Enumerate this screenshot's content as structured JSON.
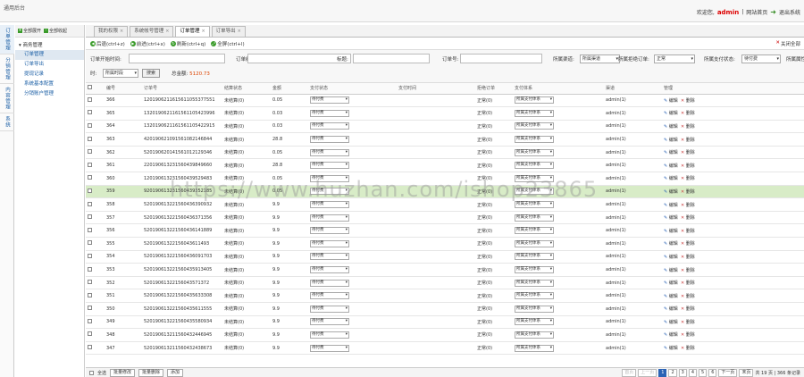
{
  "app_title": "通用后台",
  "header": {
    "welcome": "欢迎您,",
    "admin": "admin",
    "separator": "|",
    "site_home": "网站首页",
    "logout": "退出系统"
  },
  "vertical_tabs": [
    "订单管理",
    "分销管理",
    "内容管理",
    "系统"
  ],
  "sidebar": {
    "expand_all": "全部展开",
    "collapse_all": "全部收起",
    "group": "商务管理",
    "items": [
      "订单管理",
      "订单导出",
      "提现记录",
      "系统基本配置",
      "分销账户管理"
    ]
  },
  "tabs": [
    {
      "label": "我的权限",
      "close": "×"
    },
    {
      "label": "系统帐号管理",
      "close": "×"
    },
    {
      "label": "订单管理",
      "close": "×"
    },
    {
      "label": "订单导出",
      "close": "×"
    }
  ],
  "toolbar": {
    "back": "后退(ctrl+z)",
    "forward": "前进(ctrl+x)",
    "refresh": "刷新(ctrl+q)",
    "fullscreen": "全屏(ctrl+l)",
    "close_all": "关闭全部"
  },
  "filters": {
    "order_start_time": "订单开始时间:",
    "order_end_time": "订单结束时间:",
    "title": "标题:",
    "order_no": "订单号:",
    "channel": "所属渠道:",
    "channel_value": "所属渠道",
    "frozen": "所属拒绝订单:",
    "frozen_value": "正常",
    "pay_status": "所属支付状态:",
    "pay_status_value": "待付费",
    "attribute": "所属属性",
    "time": "时:",
    "time_value": "所属时段",
    "search": "搜索",
    "total_label": "总金额:",
    "total_value": "5120.73"
  },
  "table": {
    "headers": [
      "",
      "编号",
      "订单号",
      "结算状态",
      "金额",
      "支付状态",
      "支付时间",
      "拒绝订单",
      "支付体系",
      "渠道",
      "管理"
    ],
    "edit": "编辑",
    "delete": "删除",
    "rows": [
      {
        "id": "366",
        "order": "12019062116156110553775​51",
        "settle": "未结算(0)",
        "amount": "0.05",
        "pay": "待付费",
        "pay_time": "",
        "reject": "正常(0)",
        "system": "所属支付体系",
        "channel": "admin(1)"
      },
      {
        "id": "365",
        "order": "13201906211615611054239​96",
        "settle": "未结算(0)",
        "amount": "0.03",
        "pay": "待付费",
        "pay_time": "",
        "reject": "正常(0)",
        "system": "所属支付体系",
        "channel": "admin(1)"
      },
      {
        "id": "364",
        "order": "13201906211615611054229​15",
        "settle": "未结算(0)",
        "amount": "0.03",
        "pay": "待付费",
        "pay_time": "",
        "reject": "正常(0)",
        "system": "所属支付体系",
        "channel": "admin(1)"
      },
      {
        "id": "363",
        "order": "42019062109156108214684​4",
        "settle": "未结算(0)",
        "amount": "28.8",
        "pay": "待付费",
        "pay_time": "",
        "reject": "正常(0)",
        "system": "所属支付体系",
        "channel": "admin(1)"
      },
      {
        "id": "362",
        "order": "52019062014156101212934​6",
        "settle": "未结算(0)",
        "amount": "0.05",
        "pay": "待付费",
        "pay_time": "",
        "reject": "正常(0)",
        "system": "所属支付体系",
        "channel": "admin(1)"
      },
      {
        "id": "361",
        "order": "22019061323156043984966​0",
        "settle": "未结算(0)",
        "amount": "28.8",
        "pay": "待付费",
        "pay_time": "",
        "reject": "正常(0)",
        "system": "所属支付体系",
        "channel": "admin(1)"
      },
      {
        "id": "360",
        "order": "12019061323156043952948​3",
        "settle": "未结算(0)",
        "amount": "0.05",
        "pay": "待付费",
        "pay_time": "",
        "reject": "正常(0)",
        "system": "所属支付体系",
        "channel": "admin(1)"
      },
      {
        "id": "359",
        "order": "92019061323156043935218​5",
        "settle": "未结算(0)",
        "amount": "0.05",
        "pay": "待付费",
        "pay_time": "",
        "reject": "正常(0)",
        "system": "所属支付体系",
        "channel": "admin(1)"
      },
      {
        "id": "358",
        "order": "52019061322156043639093​2",
        "settle": "未结算(0)",
        "amount": "9.9",
        "pay": "待付费",
        "pay_time": "",
        "reject": "正常(0)",
        "system": "所属支付体系",
        "channel": "admin(1)"
      },
      {
        "id": "357",
        "order": "52019061322156043637135​6",
        "settle": "未结算(0)",
        "amount": "9.9",
        "pay": "待付费",
        "pay_time": "",
        "reject": "正常(0)",
        "system": "所属支付体系",
        "channel": "admin(1)"
      },
      {
        "id": "356",
        "order": "52019061322156043614188​9",
        "settle": "未结算(0)",
        "amount": "9.9",
        "pay": "待付费",
        "pay_time": "",
        "reject": "正常(0)",
        "system": "所属支付体系",
        "channel": "admin(1)"
      },
      {
        "id": "355",
        "order": "52019061322156043611493",
        "settle": "未结算(0)",
        "amount": "9.9",
        "pay": "待付费",
        "pay_time": "",
        "reject": "正常(0)",
        "system": "所属支付体系",
        "channel": "admin(1)"
      },
      {
        "id": "354",
        "order": "52019061322156043609170​3",
        "settle": "未结算(0)",
        "amount": "9.9",
        "pay": "待付费",
        "pay_time": "",
        "reject": "正常(0)",
        "system": "所属支付体系",
        "channel": "admin(1)"
      },
      {
        "id": "353",
        "order": "52019061322156043591340​5",
        "settle": "未结算(0)",
        "amount": "9.9",
        "pay": "待付费",
        "pay_time": "",
        "reject": "正常(0)",
        "system": "所属支付体系",
        "channel": "admin(1)"
      },
      {
        "id": "352",
        "order": "52019061322156043571372",
        "settle": "未结算(0)",
        "amount": "9.9",
        "pay": "待付费",
        "pay_time": "",
        "reject": "正常(0)",
        "system": "所属支付体系",
        "channel": "admin(1)"
      },
      {
        "id": "351",
        "order": "52019061322156043563330​8",
        "settle": "未结算(0)",
        "amount": "9.9",
        "pay": "待付费",
        "pay_time": "",
        "reject": "正常(0)",
        "system": "所属支付体系",
        "channel": "admin(1)"
      },
      {
        "id": "350",
        "order": "52019061322156043561155​5",
        "settle": "未结算(0)",
        "amount": "9.9",
        "pay": "待付费",
        "pay_time": "",
        "reject": "正常(0)",
        "system": "所属支付体系",
        "channel": "admin(1)"
      },
      {
        "id": "349",
        "order": "52019061322156043558093​4",
        "settle": "未结算(0)",
        "amount": "9.9",
        "pay": "待付费",
        "pay_time": "",
        "reject": "正常(0)",
        "system": "所属支付体系",
        "channel": "admin(1)"
      },
      {
        "id": "348",
        "order": "52019061321156043244694​5",
        "settle": "未结算(0)",
        "amount": "9.9",
        "pay": "待付费",
        "pay_time": "",
        "reject": "正常(0)",
        "system": "所属支付体系",
        "channel": "admin(1)"
      },
      {
        "id": "347",
        "order": "52019061321156043243867​3",
        "settle": "未结算(0)",
        "amount": "9.9",
        "pay": "待付费",
        "pay_time": "",
        "reject": "正常(0)",
        "system": "所属支付体系",
        "channel": "admin(1)"
      }
    ]
  },
  "footer": {
    "select_all": "全选",
    "batch_edit": "批量修改",
    "batch_delete": "批量删除",
    "add": "添加",
    "prev_pages": [
      "首页",
      "上一页"
    ],
    "pages": [
      "1",
      "2",
      "3",
      "4",
      "5",
      "6"
    ],
    "next": "下一页",
    "last": "末页",
    "summary": "共 19 页 | 366 条记录"
  },
  "watermark": "https://www.huzhan.com/ishop23865"
}
